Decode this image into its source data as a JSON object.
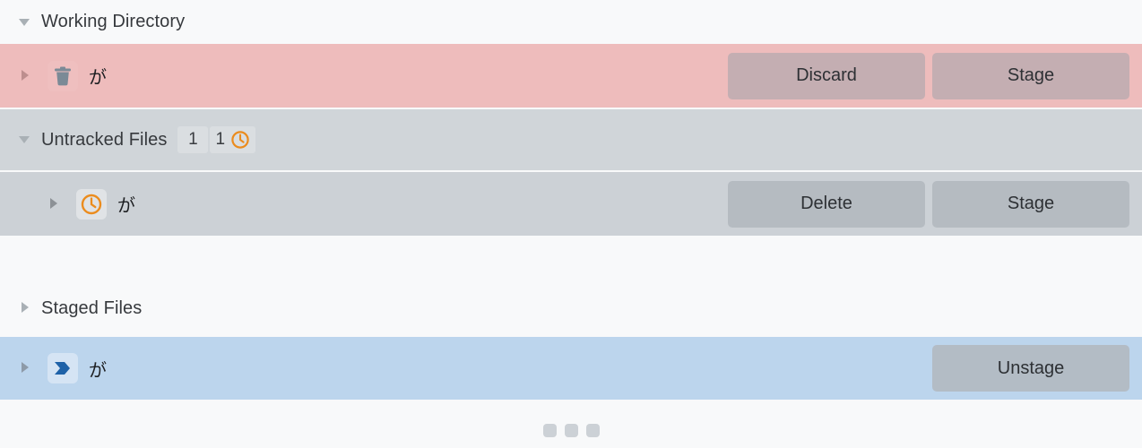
{
  "sections": [
    {
      "id": "working-directory",
      "title": "Working Directory",
      "expanded_icon": "triangle-down-icon"
    },
    {
      "id": "untracked-files",
      "title": "Untracked Files",
      "expanded_icon": "triangle-down-icon",
      "badges": [
        {
          "count": "1"
        },
        {
          "count": "1",
          "icon": "clock-icon"
        }
      ]
    },
    {
      "id": "staged-files",
      "title": "Staged Files",
      "expanded_icon": "triangle-right-icon"
    }
  ],
  "rows": [
    {
      "id": "working-directory-file",
      "disclosure_icon": "triangle-right-icon",
      "status_icon": "trash-icon",
      "filename": "が",
      "buttons": [
        {
          "id": "discard",
          "label": "Discard"
        },
        {
          "id": "stage",
          "label": "Stage"
        }
      ]
    },
    {
      "id": "untracked-file",
      "disclosure_icon": "triangle-right-icon",
      "status_icon": "clock-icon",
      "filename": "が",
      "buttons": [
        {
          "id": "delete",
          "label": "Delete"
        },
        {
          "id": "stage",
          "label": "Stage"
        }
      ]
    },
    {
      "id": "staged-file",
      "disclosure_icon": "triangle-right-icon",
      "status_icon": "chevron-right-badge-icon",
      "filename": "が",
      "buttons": [
        {
          "id": "unstage",
          "label": "Unstage"
        }
      ]
    }
  ],
  "progress": {
    "dots": 3
  },
  "colors": {
    "background": "#f8f9fa",
    "working_row": "#eebcbc",
    "untracked_section": "#d0d5d9",
    "staged_row": "#bcd5ed",
    "clock_accent": "#eb8c1e",
    "staged_icon": "#1f62a8",
    "trash_icon": "#7b8a96"
  }
}
